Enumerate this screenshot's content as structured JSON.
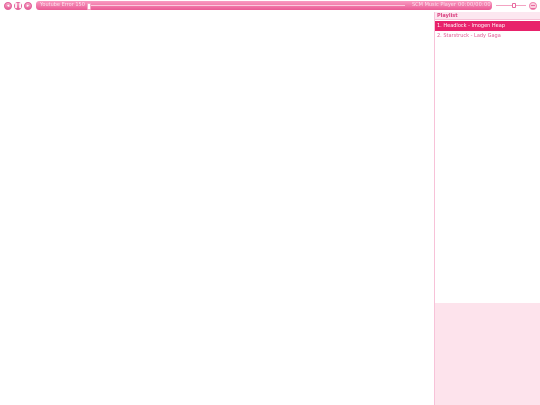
{
  "player": {
    "controls": {
      "prev_glyph": "◂",
      "pause_glyph": "❚❚",
      "next_glyph": "▸"
    },
    "status": "Youtube Error 150",
    "title": "SCM Music Player",
    "time": "00:00/00:00",
    "volume_level": 0.6
  },
  "playlist": {
    "header": "Playlist",
    "items": [
      {
        "label": "1. Headlock - Imogen Heap",
        "active": true
      },
      {
        "label": "2. Starstruck - Lady Gaga",
        "active": false
      }
    ]
  },
  "colors": {
    "accent": "#e8226b",
    "bar_pink": "#ea5a95",
    "panel_tint": "#fde3ec"
  },
  "icons": {
    "prev": "previous-icon",
    "pause": "pause-icon",
    "next": "next-icon",
    "menu": "menu-icon"
  }
}
